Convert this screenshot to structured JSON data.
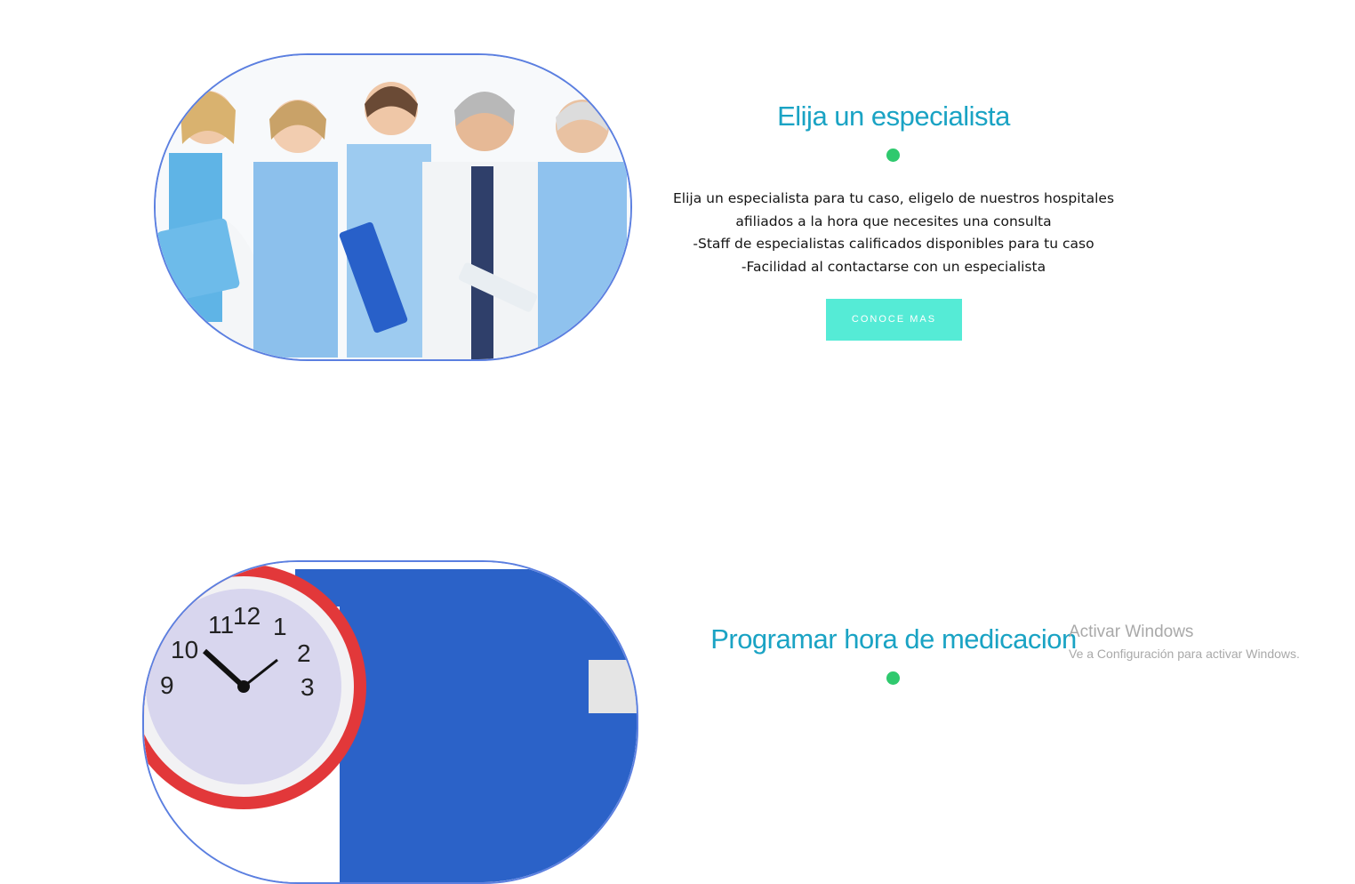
{
  "features": [
    {
      "title": "Elija un especialista",
      "description_lines": [
        "Elija un especialista para tu caso, eligelo de nuestros hospitales",
        "afiliados a la hora que necesites una consulta",
        "-Staff de especialistas calificados disponibles para tu caso",
        "-Facilidad al contactarse con un especialista"
      ],
      "button_label": "CONOCE MAS",
      "image": "medical-team-photo"
    },
    {
      "title": "Programar hora de medicacion",
      "image": "alarm-clock-photo"
    }
  ],
  "watermark": {
    "title": "Activar Windows",
    "subtitle": "Ve a Configuración para activar Windows."
  },
  "colors": {
    "title": "#1aa3c4",
    "dot": "#2fc96e",
    "button": "#55ebd6",
    "frame_border": "#5b7fe0"
  }
}
